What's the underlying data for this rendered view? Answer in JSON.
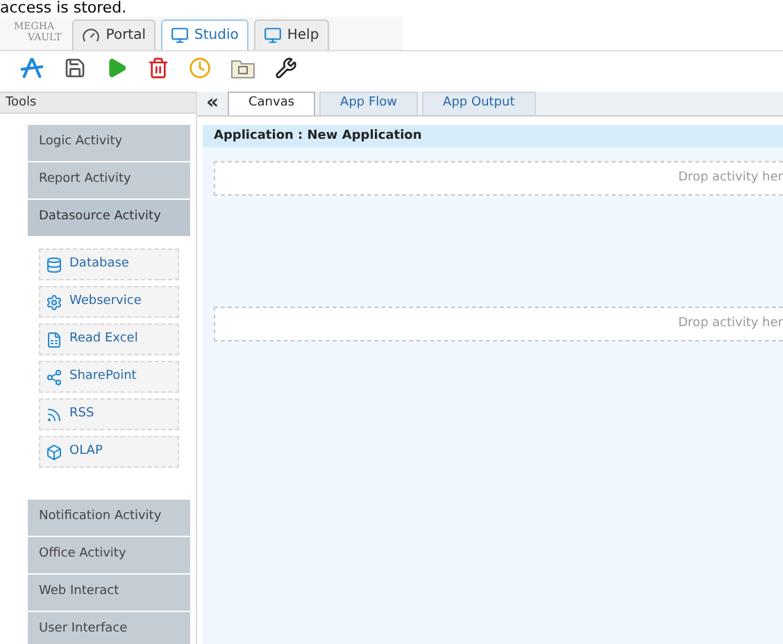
{
  "caption": "access is stored.",
  "logo": {
    "line_1": "MEGHA",
    "line_2": "VAULT"
  },
  "top_tabs": [
    {
      "label": "Portal",
      "selected": false
    },
    {
      "label": "Studio",
      "selected": true
    },
    {
      "label": "Help",
      "selected": false
    }
  ],
  "sidebar": {
    "title": "Tools",
    "categories": [
      {
        "label": "Logic Activity",
        "expanded": false
      },
      {
        "label": "Report Activity",
        "expanded": false
      },
      {
        "label": "Datasource Activity",
        "expanded": true,
        "children": [
          {
            "label": "Database"
          },
          {
            "label": "Webservice"
          },
          {
            "label": "Read Excel"
          },
          {
            "label": "SharePoint"
          },
          {
            "label": "RSS"
          },
          {
            "label": "OLAP"
          }
        ]
      },
      {
        "label": "Notification Activity",
        "expanded": false
      },
      {
        "label": "Office Activity",
        "expanded": false
      },
      {
        "label": "Web Interact",
        "expanded": false
      },
      {
        "label": "User Interface",
        "expanded": false
      }
    ]
  },
  "collapse_glyph": "«",
  "canvas_tabs": [
    {
      "label": "Canvas",
      "selected": true
    },
    {
      "label": "App Flow",
      "selected": false
    },
    {
      "label": "App Output",
      "selected": false
    }
  ],
  "application_title": "Application : New Application",
  "drop_zones": [
    "Drop activity her",
    "Drop activity her"
  ]
}
